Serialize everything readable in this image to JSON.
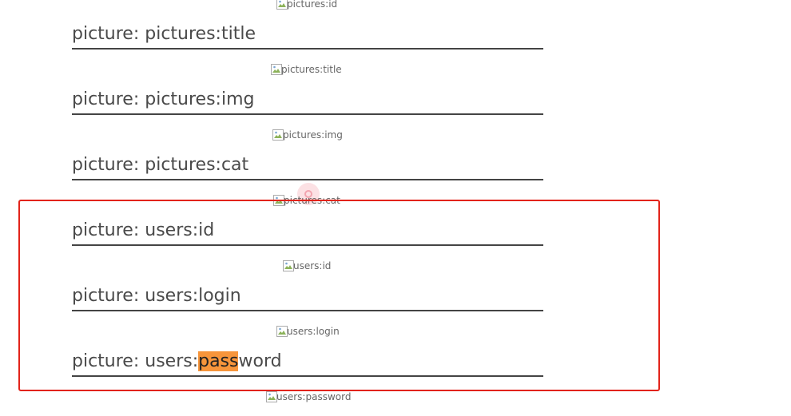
{
  "images": [
    {
      "alt": "pictures:id"
    },
    {
      "alt": "pictures:title"
    },
    {
      "alt": "pictures:img"
    },
    {
      "alt": "pictures:cat"
    },
    {
      "alt": "users:id"
    },
    {
      "alt": "users:login"
    },
    {
      "alt": "users:password"
    }
  ],
  "headings": [
    {
      "prefix": "picture: ",
      "text": "pictures:title"
    },
    {
      "prefix": "picture: ",
      "text": "pictures:img"
    },
    {
      "prefix": "picture: ",
      "text": "pictures:cat"
    },
    {
      "prefix": "picture: ",
      "text": "users:id"
    },
    {
      "prefix": "picture: ",
      "text": "users:login"
    },
    {
      "prefix": "picture: ",
      "text_before": "users:",
      "highlight": "pass",
      "text_after": "word"
    }
  ],
  "colors": {
    "highlight": "#f7953b",
    "selection_box": "#e2231a"
  },
  "icons": {
    "broken_image": "broken-image-icon"
  }
}
